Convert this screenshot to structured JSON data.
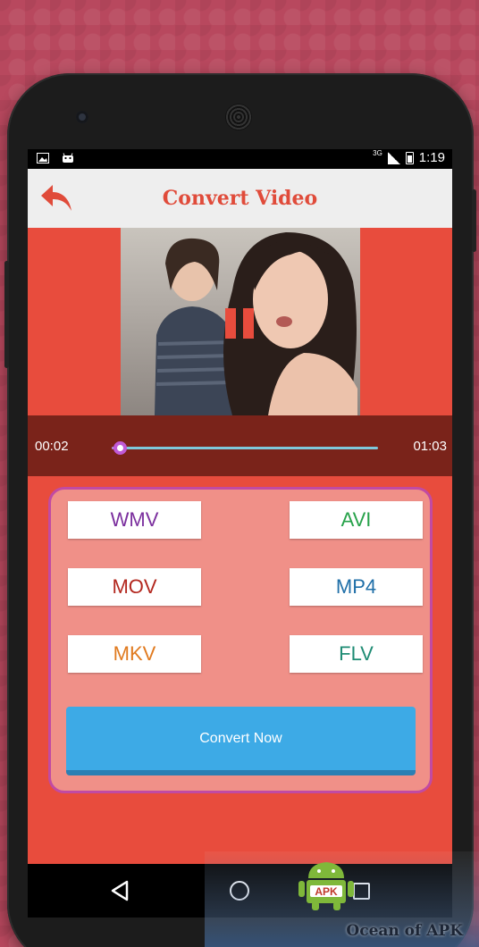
{
  "status_bar": {
    "network": "3G",
    "time": "1:19",
    "icons": [
      "image-icon",
      "android-debug-icon",
      "signal-icon",
      "battery-charging-icon"
    ]
  },
  "app_bar": {
    "title": "Convert Video",
    "back_icon": "reply-arrow-icon"
  },
  "player": {
    "current_time": "00:02",
    "total_time": "01:03",
    "progress_fraction": 0.03,
    "pause_icon": "pause-icon"
  },
  "formats": [
    {
      "label": "WMV",
      "color": "#7b2f9e"
    },
    {
      "label": "AVI",
      "color": "#27a24a"
    },
    {
      "label": "MOV",
      "color": "#b3271e"
    },
    {
      "label": "MP4",
      "color": "#1f6fa8"
    },
    {
      "label": "MKV",
      "color": "#e07a1f"
    },
    {
      "label": "FLV",
      "color": "#1f8c74"
    }
  ],
  "convert_button": {
    "label": "Convert Now"
  },
  "nav_bar": {
    "icons": [
      "back-triangle-icon",
      "home-circle-icon",
      "recents-square-icon"
    ]
  },
  "watermark": {
    "text": "Ocean of APK",
    "logo_text": "APK"
  },
  "colors": {
    "accent": "#e84c3d",
    "seek_bg": "#7a231a",
    "panel": "#f09088",
    "panel_border": "#c14aa3",
    "convert_button": "#3daae6"
  }
}
